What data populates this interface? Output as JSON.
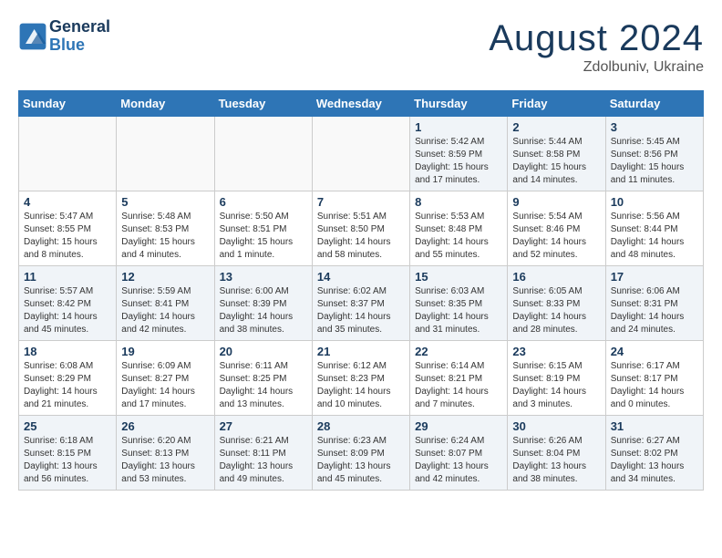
{
  "header": {
    "logo_line1": "General",
    "logo_line2": "Blue",
    "month_year": "August 2024",
    "location": "Zdolbuniv, Ukraine"
  },
  "weekdays": [
    "Sunday",
    "Monday",
    "Tuesday",
    "Wednesday",
    "Thursday",
    "Friday",
    "Saturday"
  ],
  "weeks": [
    [
      {
        "day": "",
        "info": "",
        "empty": true
      },
      {
        "day": "",
        "info": "",
        "empty": true
      },
      {
        "day": "",
        "info": "",
        "empty": true
      },
      {
        "day": "",
        "info": "",
        "empty": true
      },
      {
        "day": "1",
        "info": "Sunrise: 5:42 AM\nSunset: 8:59 PM\nDaylight: 15 hours\nand 17 minutes."
      },
      {
        "day": "2",
        "info": "Sunrise: 5:44 AM\nSunset: 8:58 PM\nDaylight: 15 hours\nand 14 minutes."
      },
      {
        "day": "3",
        "info": "Sunrise: 5:45 AM\nSunset: 8:56 PM\nDaylight: 15 hours\nand 11 minutes."
      }
    ],
    [
      {
        "day": "4",
        "info": "Sunrise: 5:47 AM\nSunset: 8:55 PM\nDaylight: 15 hours\nand 8 minutes."
      },
      {
        "day": "5",
        "info": "Sunrise: 5:48 AM\nSunset: 8:53 PM\nDaylight: 15 hours\nand 4 minutes."
      },
      {
        "day": "6",
        "info": "Sunrise: 5:50 AM\nSunset: 8:51 PM\nDaylight: 15 hours\nand 1 minute."
      },
      {
        "day": "7",
        "info": "Sunrise: 5:51 AM\nSunset: 8:50 PM\nDaylight: 14 hours\nand 58 minutes."
      },
      {
        "day": "8",
        "info": "Sunrise: 5:53 AM\nSunset: 8:48 PM\nDaylight: 14 hours\nand 55 minutes."
      },
      {
        "day": "9",
        "info": "Sunrise: 5:54 AM\nSunset: 8:46 PM\nDaylight: 14 hours\nand 52 minutes."
      },
      {
        "day": "10",
        "info": "Sunrise: 5:56 AM\nSunset: 8:44 PM\nDaylight: 14 hours\nand 48 minutes."
      }
    ],
    [
      {
        "day": "11",
        "info": "Sunrise: 5:57 AM\nSunset: 8:42 PM\nDaylight: 14 hours\nand 45 minutes."
      },
      {
        "day": "12",
        "info": "Sunrise: 5:59 AM\nSunset: 8:41 PM\nDaylight: 14 hours\nand 42 minutes."
      },
      {
        "day": "13",
        "info": "Sunrise: 6:00 AM\nSunset: 8:39 PM\nDaylight: 14 hours\nand 38 minutes."
      },
      {
        "day": "14",
        "info": "Sunrise: 6:02 AM\nSunset: 8:37 PM\nDaylight: 14 hours\nand 35 minutes."
      },
      {
        "day": "15",
        "info": "Sunrise: 6:03 AM\nSunset: 8:35 PM\nDaylight: 14 hours\nand 31 minutes."
      },
      {
        "day": "16",
        "info": "Sunrise: 6:05 AM\nSunset: 8:33 PM\nDaylight: 14 hours\nand 28 minutes."
      },
      {
        "day": "17",
        "info": "Sunrise: 6:06 AM\nSunset: 8:31 PM\nDaylight: 14 hours\nand 24 minutes."
      }
    ],
    [
      {
        "day": "18",
        "info": "Sunrise: 6:08 AM\nSunset: 8:29 PM\nDaylight: 14 hours\nand 21 minutes."
      },
      {
        "day": "19",
        "info": "Sunrise: 6:09 AM\nSunset: 8:27 PM\nDaylight: 14 hours\nand 17 minutes."
      },
      {
        "day": "20",
        "info": "Sunrise: 6:11 AM\nSunset: 8:25 PM\nDaylight: 14 hours\nand 13 minutes."
      },
      {
        "day": "21",
        "info": "Sunrise: 6:12 AM\nSunset: 8:23 PM\nDaylight: 14 hours\nand 10 minutes."
      },
      {
        "day": "22",
        "info": "Sunrise: 6:14 AM\nSunset: 8:21 PM\nDaylight: 14 hours\nand 7 minutes."
      },
      {
        "day": "23",
        "info": "Sunrise: 6:15 AM\nSunset: 8:19 PM\nDaylight: 14 hours\nand 3 minutes."
      },
      {
        "day": "24",
        "info": "Sunrise: 6:17 AM\nSunset: 8:17 PM\nDaylight: 14 hours\nand 0 minutes."
      }
    ],
    [
      {
        "day": "25",
        "info": "Sunrise: 6:18 AM\nSunset: 8:15 PM\nDaylight: 13 hours\nand 56 minutes."
      },
      {
        "day": "26",
        "info": "Sunrise: 6:20 AM\nSunset: 8:13 PM\nDaylight: 13 hours\nand 53 minutes."
      },
      {
        "day": "27",
        "info": "Sunrise: 6:21 AM\nSunset: 8:11 PM\nDaylight: 13 hours\nand 49 minutes."
      },
      {
        "day": "28",
        "info": "Sunrise: 6:23 AM\nSunset: 8:09 PM\nDaylight: 13 hours\nand 45 minutes."
      },
      {
        "day": "29",
        "info": "Sunrise: 6:24 AM\nSunset: 8:07 PM\nDaylight: 13 hours\nand 42 minutes."
      },
      {
        "day": "30",
        "info": "Sunrise: 6:26 AM\nSunset: 8:04 PM\nDaylight: 13 hours\nand 38 minutes."
      },
      {
        "day": "31",
        "info": "Sunrise: 6:27 AM\nSunset: 8:02 PM\nDaylight: 13 hours\nand 34 minutes."
      }
    ]
  ]
}
